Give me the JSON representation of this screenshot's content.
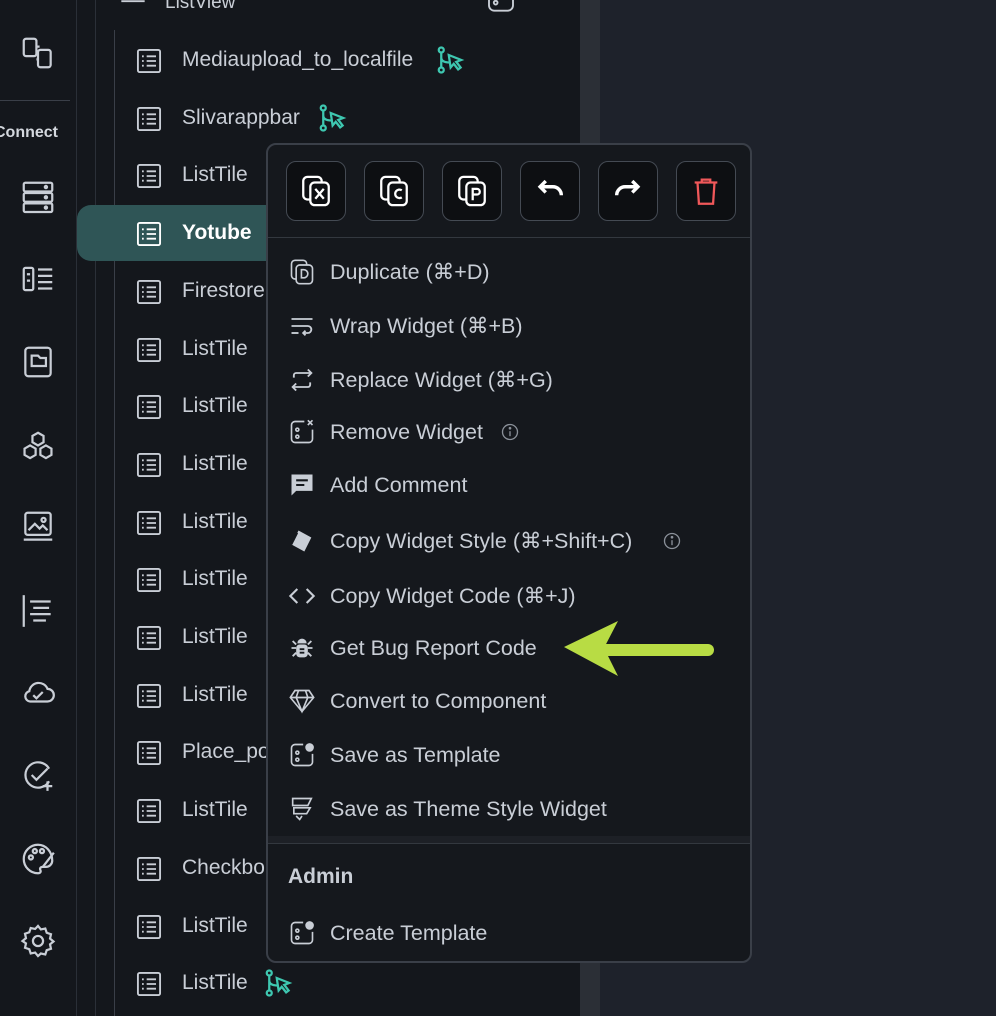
{
  "rail": {
    "connect_label": "Connect",
    "icons": [
      "connect-icon",
      "database-icon",
      "components-icon",
      "folder-icon",
      "hex-icon",
      "media-icon",
      "text-icon",
      "cloud-icon",
      "check-add-icon",
      "palette-icon",
      "settings-icon"
    ]
  },
  "tree": {
    "header_label": "ListView",
    "rows": [
      {
        "label": "Mediaupload_to_localfile",
        "branch": true
      },
      {
        "label": "Slivarappbar",
        "branch": true
      },
      {
        "label": "ListTile",
        "branch": false
      },
      {
        "label": "Yotube",
        "branch": false,
        "selected": true
      },
      {
        "label": "Firestore",
        "branch": false
      },
      {
        "label": "ListTile",
        "branch": false
      },
      {
        "label": "ListTile",
        "branch": false
      },
      {
        "label": "ListTile",
        "branch": false
      },
      {
        "label": "ListTile",
        "branch": false
      },
      {
        "label": "ListTile",
        "branch": false
      },
      {
        "label": "ListTile",
        "branch": false
      },
      {
        "label": "ListTile",
        "branch": false
      },
      {
        "label": "Place_po",
        "branch": false
      },
      {
        "label": "ListTile",
        "branch": false
      },
      {
        "label": "Checkbo",
        "branch": false
      },
      {
        "label": "ListTile",
        "branch": false
      },
      {
        "label": "ListTile",
        "branch": true
      }
    ]
  },
  "menu": {
    "toolbar": [
      "cut-icon",
      "copy-icon",
      "paste-icon",
      "undo-icon",
      "redo-icon",
      "delete-icon"
    ],
    "items": [
      {
        "label": "Duplicate (⌘+D)",
        "icon": "duplicate-icon"
      },
      {
        "label": "Wrap Widget (⌘+B)",
        "icon": "wrap-icon"
      },
      {
        "label": "Replace Widget (⌘+G)",
        "icon": "replace-icon"
      },
      {
        "label": "Remove Widget",
        "icon": "remove-widget-icon",
        "info": true
      },
      {
        "label": "Add Comment",
        "icon": "comment-icon"
      },
      {
        "label": "Copy Widget Style (⌘+Shift+C)",
        "icon": "paint-bucket-icon",
        "info": true
      },
      {
        "label": "Copy Widget Code (⌘+J)",
        "icon": "code-icon"
      },
      {
        "label": "Get Bug Report Code",
        "icon": "bug-icon"
      },
      {
        "label": "Convert to Component",
        "icon": "diamond-icon"
      },
      {
        "label": "Save as Template",
        "icon": "template-icon"
      },
      {
        "label": "Save as Theme Style Widget",
        "icon": "theme-style-icon"
      }
    ],
    "admin_label": "Admin",
    "admin_items": [
      {
        "label": "Create Template",
        "icon": "template-icon"
      }
    ]
  },
  "colors": {
    "accent_teal": "#3ec7b0",
    "selected_row": "#2f5556",
    "delete_red": "#f0585a",
    "arrow_green": "#b8dc44"
  }
}
